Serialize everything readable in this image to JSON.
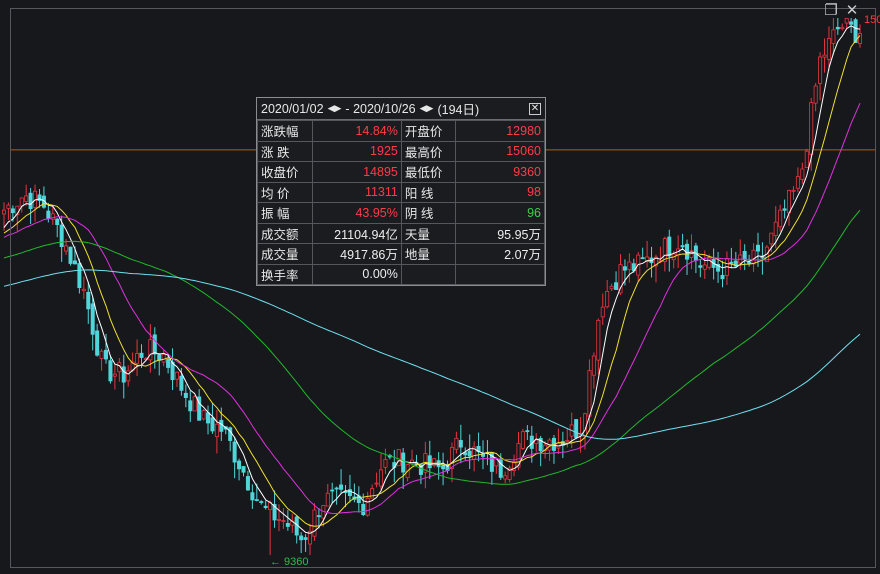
{
  "colors": {
    "up": "#e8343f",
    "down": "#4fd6da",
    "ma5": "#ffffff",
    "ma10": "#f2e12c",
    "ma20": "#e030e0",
    "ma60": "#22b82f",
    "ma120": "#6fe0f0",
    "ref": "#b85a1c",
    "bg": "#17181c"
  },
  "window": {
    "restore_icon": "restore-icon",
    "close_icon": "close-icon"
  },
  "labels": {
    "high": "150",
    "low": "← 9360"
  },
  "popup": {
    "start": "2020/01/02",
    "end": "2020/10/26",
    "sep": "-",
    "days": "(194日)",
    "rows": [
      [
        {
          "l": "涨跌幅",
          "v": "14.84%",
          "c": "red"
        },
        {
          "l": "开盘价",
          "v": "12980",
          "c": "red"
        }
      ],
      [
        {
          "l": "涨  跌",
          "v": "1925",
          "c": "red"
        },
        {
          "l": "最高价",
          "v": "15060",
          "c": "red"
        }
      ],
      [
        {
          "l": "收盘价",
          "v": "14895",
          "c": "red"
        },
        {
          "l": "最低价",
          "v": "9360",
          "c": "red"
        }
      ],
      [
        {
          "l": "均  价",
          "v": "11311",
          "c": "red"
        },
        {
          "l": "阳  线",
          "v": "98",
          "c": "red"
        }
      ],
      [
        {
          "l": "振  幅",
          "v": "43.95%",
          "c": "red"
        },
        {
          "l": "阴  线",
          "v": "96",
          "c": "green"
        }
      ],
      [
        {
          "l": "成交额",
          "v": "21104.94亿",
          "c": "white"
        },
        {
          "l": "天量",
          "v": "95.95万",
          "c": "white"
        }
      ],
      [
        {
          "l": "成交量",
          "v": "4917.86万",
          "c": "white"
        },
        {
          "l": "地量",
          "v": "2.07万",
          "c": "white"
        }
      ],
      [
        {
          "l": "换手率",
          "v": "0.00%",
          "c": "white"
        },
        {
          "l": "",
          "v": "",
          "c": "white"
        }
      ]
    ]
  },
  "chart_data": {
    "type": "candlestick",
    "period": [
      "2020/01/02",
      "2020/10/26"
    ],
    "n_candles": 194,
    "ylim": [
      9360,
      15060
    ],
    "reference_line": 13660,
    "close_keypoints": [
      13023,
      13182,
      13076,
      12705,
      12174,
      11325,
      11272,
      11538,
      11485,
      11113,
      10795,
      10689,
      10265,
      9840,
      9734,
      9522,
      9946,
      9946,
      9893,
      10318,
      10371,
      10318,
      10265,
      10583,
      10371,
      10265,
      10583,
      10583,
      10583,
      10742,
      12068,
      12386,
      12439,
      12598,
      12705,
      12439,
      12386,
      12439,
      12492,
      12917,
      13341,
      14614,
      14986,
      14895
    ],
    "moving_averages": [
      "MA5",
      "MA10",
      "MA20",
      "MA60",
      "MA120"
    ]
  }
}
